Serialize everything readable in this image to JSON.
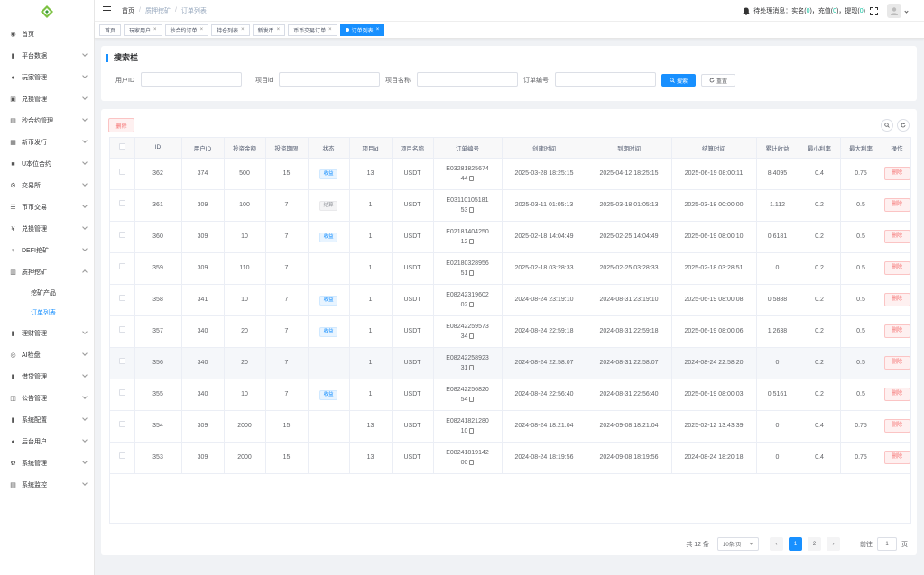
{
  "header": {
    "breadcrumb": [
      "首页",
      "质押挖矿",
      "订单列表"
    ],
    "notice_label": "待处理消息：",
    "notice_items": [
      {
        "label": "实名(",
        "count": "0",
        "suffix": ")，"
      },
      {
        "label": "充值(",
        "count": "0",
        "suffix": ")，"
      },
      {
        "label": "提现(",
        "count": "0",
        "suffix": ")"
      }
    ],
    "accent": "#1890ff"
  },
  "sidebar": {
    "items": [
      {
        "label": "首页",
        "icon": "dashboard-icon",
        "glyph": "◉",
        "chevron": false
      },
      {
        "label": "平台数据",
        "icon": "chart-icon",
        "glyph": "▮",
        "chevron": true
      },
      {
        "label": "玩家管理",
        "icon": "user-icon",
        "glyph": "●",
        "chevron": true
      },
      {
        "label": "兑换管理",
        "icon": "exchange-icon",
        "glyph": "▣",
        "chevron": true
      },
      {
        "label": "秒合约管理",
        "icon": "contract-icon",
        "glyph": "▤",
        "chevron": true
      },
      {
        "label": "新币发行",
        "icon": "coin-icon",
        "glyph": "▦",
        "chevron": true
      },
      {
        "label": "U本位合约",
        "icon": "ucontract-icon",
        "glyph": "■",
        "chevron": true
      },
      {
        "label": "交易所",
        "icon": "exchange-house-icon",
        "glyph": "⚙",
        "chevron": true
      },
      {
        "label": "币币交易",
        "icon": "list-icon",
        "glyph": "☰",
        "chevron": true
      },
      {
        "label": "兑换管理",
        "icon": "yen-icon",
        "glyph": "¥",
        "chevron": true
      },
      {
        "label": "DEFI挖矿",
        "icon": "defi-icon",
        "glyph": "♆",
        "chevron": true
      },
      {
        "label": "质押挖矿",
        "icon": "bar-chart-icon",
        "glyph": "▥",
        "chevron": true,
        "open": true
      }
    ],
    "sub_items": [
      {
        "label": "挖矿产品",
        "active": false
      },
      {
        "label": "订单列表",
        "active": true
      }
    ],
    "items_after": [
      {
        "label": "理财管理",
        "icon": "finance-icon",
        "glyph": "▮",
        "chevron": true
      },
      {
        "label": "AI检盘",
        "icon": "ai-icon",
        "glyph": "◎",
        "chevron": true
      },
      {
        "label": "借贷管理",
        "icon": "loan-icon",
        "glyph": "▮",
        "chevron": true
      },
      {
        "label": "公告管理",
        "icon": "notice-icon",
        "glyph": "◫",
        "chevron": true
      },
      {
        "label": "系统配置",
        "icon": "config-icon",
        "glyph": "▮",
        "chevron": true
      },
      {
        "label": "后台用户",
        "icon": "admin-user-icon",
        "glyph": "●",
        "chevron": true
      },
      {
        "label": "系统管理",
        "icon": "system-icon",
        "glyph": "✿",
        "chevron": true
      },
      {
        "label": "系统监控",
        "icon": "monitor-icon",
        "glyph": "▤",
        "chevron": true
      }
    ]
  },
  "tags": [
    {
      "label": "首页",
      "closable": false,
      "active": false
    },
    {
      "label": "玩家用户",
      "closable": true,
      "active": false
    },
    {
      "label": "秒合约订单",
      "closable": true,
      "active": false
    },
    {
      "label": "持仓列表",
      "closable": true,
      "active": false
    },
    {
      "label": "新发币",
      "closable": true,
      "active": false
    },
    {
      "label": "币币交易订单",
      "closable": true,
      "active": false
    },
    {
      "label": "订单列表",
      "closable": true,
      "active": true
    }
  ],
  "search": {
    "title": "搜索栏",
    "fields": [
      {
        "label": "用户ID",
        "value": ""
      },
      {
        "label": "项目id",
        "value": ""
      },
      {
        "label": "项目名称",
        "value": ""
      },
      {
        "label": "订单编号",
        "value": ""
      }
    ],
    "search_label": "搜索",
    "reset_label": "重置"
  },
  "toolbar": {
    "delete_label": "删除"
  },
  "table": {
    "columns": [
      "",
      "ID",
      "用户ID",
      "投资金额",
      "投资期限",
      "状态",
      "项目id",
      "项目名称",
      "订单编号",
      "创建时间",
      "到期时间",
      "结算时间",
      "累计收益",
      "最小利率",
      "最大利率",
      "操作"
    ],
    "row_action": "删除",
    "rows": [
      {
        "id": "362",
        "uid": "374",
        "amount": "500",
        "days": "15",
        "status": "收益",
        "status_type": "blue",
        "pid": "13",
        "pname": "USDT",
        "order_a": "E03281825674",
        "order_b": "44",
        "created": "2025-03-28 18:25:15",
        "expire": "2025-04-12 18:25:15",
        "settle": "2025-06-19 08:00:11",
        "income": "8.4095",
        "min": "0.4",
        "max": "0.75"
      },
      {
        "id": "361",
        "uid": "309",
        "amount": "100",
        "days": "7",
        "status": "结算",
        "status_type": "gray",
        "pid": "1",
        "pname": "USDT",
        "order_a": "E03110105181",
        "order_b": "53",
        "created": "2025-03-11 01:05:13",
        "expire": "2025-03-18 01:05:13",
        "settle": "2025-03-18 00:00:00",
        "income": "1.112",
        "min": "0.2",
        "max": "0.5"
      },
      {
        "id": "360",
        "uid": "309",
        "amount": "10",
        "days": "7",
        "status": "收益",
        "status_type": "blue",
        "pid": "1",
        "pname": "USDT",
        "order_a": "E02181404250",
        "order_b": "12",
        "created": "2025-02-18 14:04:49",
        "expire": "2025-02-25 14:04:49",
        "settle": "2025-06-19 08:00:10",
        "income": "0.6181",
        "min": "0.2",
        "max": "0.5"
      },
      {
        "id": "359",
        "uid": "309",
        "amount": "110",
        "days": "7",
        "status": "",
        "status_type": "",
        "pid": "1",
        "pname": "USDT",
        "order_a": "E02180328956",
        "order_b": "51",
        "created": "2025-02-18 03:28:33",
        "expire": "2025-02-25 03:28:33",
        "settle": "2025-02-18 03:28:51",
        "income": "0",
        "min": "0.2",
        "max": "0.5"
      },
      {
        "id": "358",
        "uid": "341",
        "amount": "10",
        "days": "7",
        "status": "收益",
        "status_type": "blue",
        "pid": "1",
        "pname": "USDT",
        "order_a": "E08242319602",
        "order_b": "02",
        "created": "2024-08-24 23:19:10",
        "expire": "2024-08-31 23:19:10",
        "settle": "2025-06-19 08:00:08",
        "income": "0.5888",
        "min": "0.2",
        "max": "0.5"
      },
      {
        "id": "357",
        "uid": "340",
        "amount": "20",
        "days": "7",
        "status": "收益",
        "status_type": "blue",
        "pid": "1",
        "pname": "USDT",
        "order_a": "E08242259573",
        "order_b": "34",
        "created": "2024-08-24 22:59:18",
        "expire": "2024-08-31 22:59:18",
        "settle": "2025-06-19 08:00:06",
        "income": "1.2638",
        "min": "0.2",
        "max": "0.5"
      },
      {
        "id": "356",
        "uid": "340",
        "amount": "20",
        "days": "7",
        "status": "",
        "status_type": "",
        "pid": "1",
        "pname": "USDT",
        "order_a": "E08242258923",
        "order_b": "31",
        "created": "2024-08-24 22:58:07",
        "expire": "2024-08-31 22:58:07",
        "settle": "2024-08-24 22:58:20",
        "income": "0",
        "min": "0.2",
        "max": "0.5",
        "highlight": true
      },
      {
        "id": "355",
        "uid": "340",
        "amount": "10",
        "days": "7",
        "status": "收益",
        "status_type": "blue",
        "pid": "1",
        "pname": "USDT",
        "order_a": "E08242256820",
        "order_b": "54",
        "created": "2024-08-24 22:56:40",
        "expire": "2024-08-31 22:56:40",
        "settle": "2025-06-19 08:00:03",
        "income": "0.5161",
        "min": "0.2",
        "max": "0.5"
      },
      {
        "id": "354",
        "uid": "309",
        "amount": "2000",
        "days": "15",
        "status": "",
        "status_type": "",
        "pid": "13",
        "pname": "USDT",
        "order_a": "E08241821280",
        "order_b": "10",
        "created": "2024-08-24 18:21:04",
        "expire": "2024-09-08 18:21:04",
        "settle": "2025-02-12 13:43:39",
        "income": "0",
        "min": "0.4",
        "max": "0.75"
      },
      {
        "id": "353",
        "uid": "309",
        "amount": "2000",
        "days": "15",
        "status": "",
        "status_type": "",
        "pid": "13",
        "pname": "USDT",
        "order_a": "E08241819142",
        "order_b": "00",
        "created": "2024-08-24 18:19:56",
        "expire": "2024-09-08 18:19:56",
        "settle": "2024-08-24 18:20:18",
        "income": "0",
        "min": "0.4",
        "max": "0.75"
      }
    ]
  },
  "pagination": {
    "total": "共 12 条",
    "page_size": "10条/页",
    "pages": [
      "1",
      "2"
    ],
    "current": "1",
    "goto_label": "前往",
    "goto_value": "1",
    "page_suffix": "页"
  }
}
